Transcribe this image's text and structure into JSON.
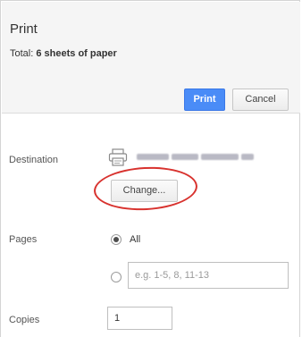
{
  "dialog": {
    "title": "Print",
    "summary_prefix": "Total: ",
    "summary_value": "6 sheets of paper",
    "print_label": "Print",
    "cancel_label": "Cancel"
  },
  "destination": {
    "label": "Destination",
    "change_label": "Change..."
  },
  "pages": {
    "label": "Pages",
    "all_label": "All",
    "custom_placeholder": "e.g. 1-5, 8, 11-13",
    "selected": "All"
  },
  "copies": {
    "label": "Copies",
    "value": "1"
  },
  "colors": {
    "accent": "#4a8cf7",
    "highlight": "#d8322e"
  }
}
